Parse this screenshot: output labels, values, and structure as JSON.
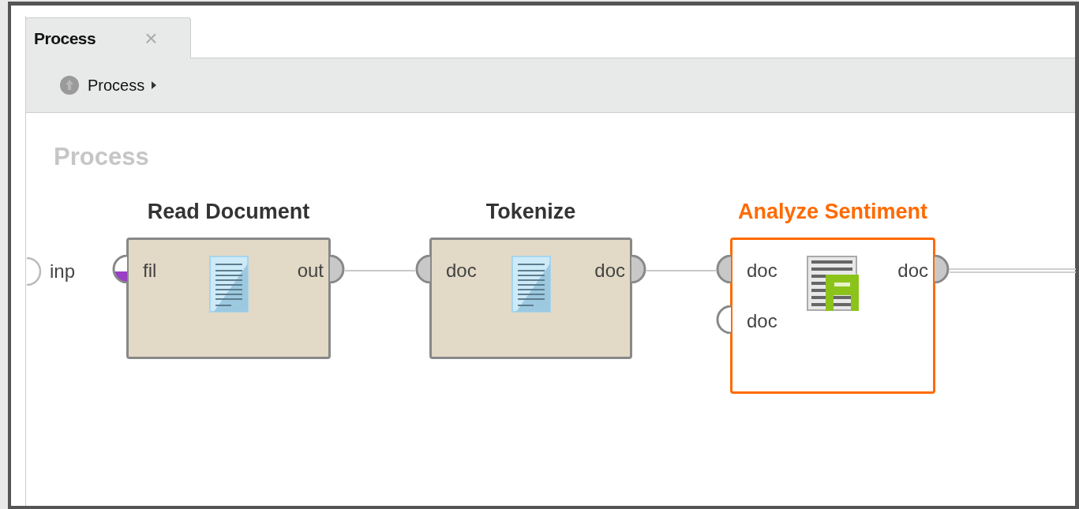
{
  "tab": {
    "label": "Process",
    "close": "×",
    "selected": true
  },
  "breadcrumb": {
    "label": "Process"
  },
  "canvas": {
    "title": "Process",
    "input_ports": [
      {
        "label": "inp",
        "connected": false
      }
    ],
    "operators": [
      {
        "name": "Read Document",
        "selected": false,
        "kind": "document",
        "inputs": [
          {
            "label": "fil",
            "connected": false,
            "color": "#9b3fc6"
          }
        ],
        "outputs": [
          {
            "label": "out",
            "connected": true
          }
        ]
      },
      {
        "name": "Tokenize",
        "selected": false,
        "kind": "document",
        "inputs": [
          {
            "label": "doc",
            "connected": true
          }
        ],
        "outputs": [
          {
            "label": "doc",
            "connected": true
          }
        ]
      },
      {
        "name": "Analyze Sentiment",
        "selected": true,
        "kind": "sentiment",
        "inputs": [
          {
            "label": "doc",
            "connected": true
          },
          {
            "label": "doc",
            "connected": false
          }
        ],
        "outputs": [
          {
            "label": "doc",
            "connected": true
          }
        ]
      }
    ]
  }
}
